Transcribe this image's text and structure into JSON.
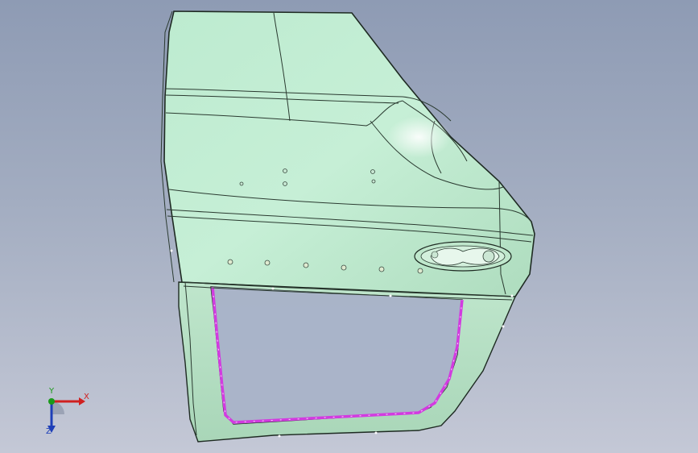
{
  "viewport": {
    "background_top": "#8e9bb4",
    "background_bottom": "#c4c8d6"
  },
  "model": {
    "part": "car-door-panel",
    "surface_color": "#c4ecd3",
    "edge_color": "#1e2a22",
    "seal_color": "#d23be0"
  },
  "triad": {
    "x_label": "X",
    "y_label": "Y",
    "z_label": "Z",
    "x_color": "#d02020",
    "y_color": "#1a9a1a",
    "z_color": "#1e3fb8"
  }
}
